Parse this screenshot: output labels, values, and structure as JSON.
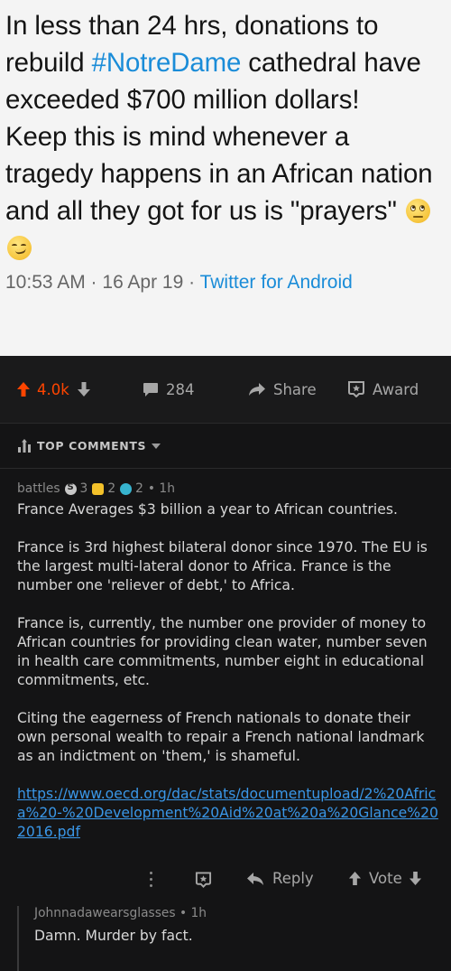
{
  "tweet": {
    "text_before_hashtag": "In less than 24 hrs, donations to rebuild ",
    "hashtag": "#NotreDame",
    "text_after_hashtag": " cathedral have exceeded $700 million dollars!",
    "text_line2": "Keep this is mind whenever a tragedy happens in an African nation and all they got for us is \"prayers\"",
    "emojis": [
      "face-with-rolling-eyes-icon",
      "smirking-face-icon"
    ],
    "timestamp": "10:53 AM · 16 Apr 19 · ",
    "source": "Twitter for Android",
    "colors": {
      "hashtag": "#1a8cd8",
      "background": "#f4f4f4"
    }
  },
  "post_actions": {
    "votes": "4.0k",
    "comments": "284",
    "share_label": "Share",
    "award_label": "Award",
    "colors": {
      "upvote_active": "#ff4500",
      "muted": "#a7a7a7"
    }
  },
  "sort": {
    "label": "TOP COMMENTS"
  },
  "comment": {
    "author": "battles",
    "awards": {
      "silver": "3",
      "gold": "2",
      "helpful": "2"
    },
    "age": "• 1h",
    "paragraphs": [
      "France Averages $3 billion a year to African countries.",
      "France is 3rd highest bilateral donor since 1970. The EU is the largest multi-lateral donor to Africa. France is the number one 'reliever of debt,' to Africa.",
      "France is, currently, the number one provider of money to African countries for providing clean water, number seven in health care commitments, number eight in educational commitments, etc.",
      "Citing the eagerness of French nationals to donate their own personal wealth to repair a French national landmark as an indictment on 'them,' is shameful."
    ],
    "link": "https://www.oecd.org/dac/stats/documentupload/2%20Africa%20-%20Development%20Aid%20at%20a%20Glance%202016.pdf",
    "tools": {
      "reply_label": "Reply",
      "vote_label": "Vote"
    },
    "colors": {
      "link": "#3a97e8"
    }
  },
  "reply": {
    "author": "Johnnadawearsglasses",
    "age": "• 1h",
    "text": "Damn. Murder by fact."
  }
}
